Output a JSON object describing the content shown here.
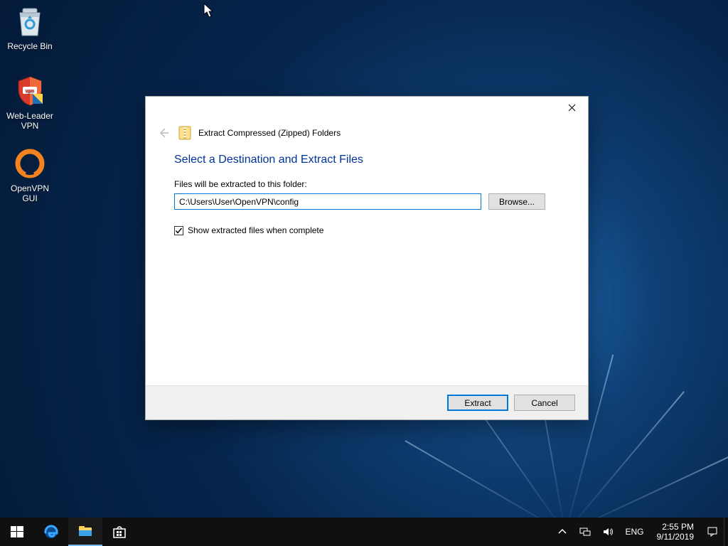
{
  "desktop": {
    "icons": [
      {
        "name": "recycle-bin",
        "label": "Recycle Bin"
      },
      {
        "name": "webleader-vpn",
        "label": "Web-Leader\nVPN"
      },
      {
        "name": "openvpn-gui",
        "label": "OpenVPN GUI"
      }
    ]
  },
  "dialog": {
    "window_title": "Extract Compressed (Zipped) Folders",
    "heading": "Select a Destination and Extract Files",
    "field_label": "Files will be extracted to this folder:",
    "path_value": "C:\\Users\\User\\OpenVPN\\config",
    "browse_label": "Browse...",
    "checkbox_label": "Show extracted files when complete",
    "checkbox_checked": true,
    "buttons": {
      "primary": "Extract",
      "secondary": "Cancel"
    }
  },
  "taskbar": {
    "lang": "ENG",
    "time": "2:55 PM",
    "date": "9/11/2019"
  },
  "colors": {
    "accent": "#0078d7",
    "link_heading": "#003399"
  }
}
